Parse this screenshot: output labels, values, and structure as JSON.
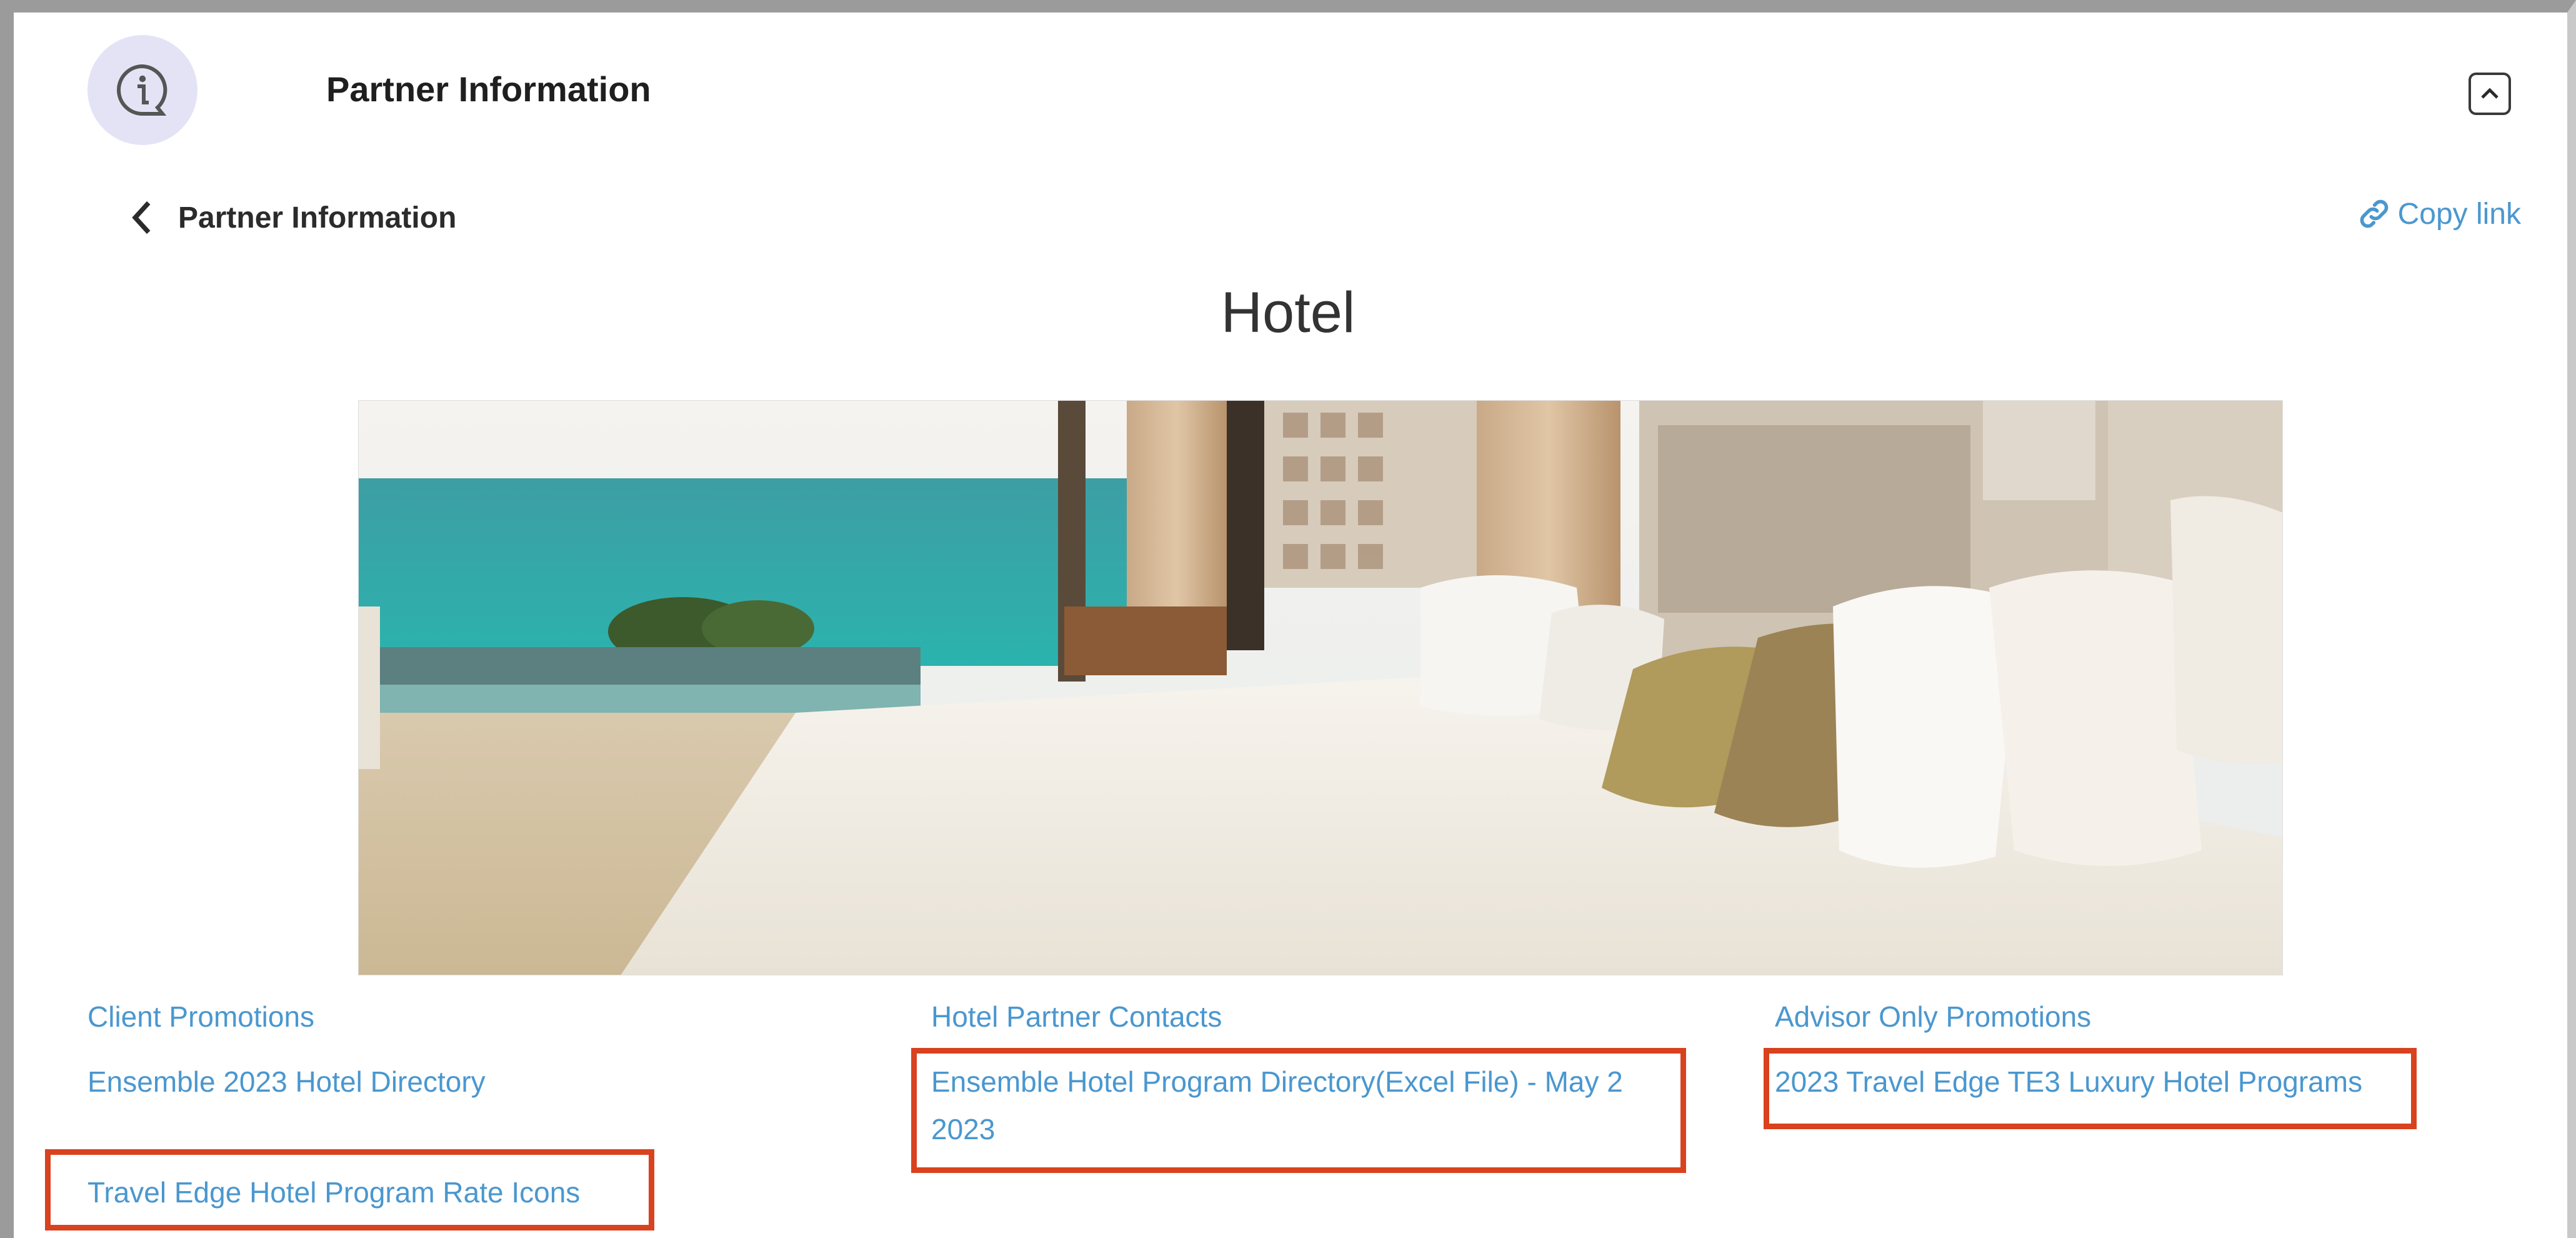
{
  "header": {
    "title": "Partner Information",
    "icon": "info-chat-icon",
    "collapse_icon": "chevron-up-icon"
  },
  "nav": {
    "back_label": "Partner Information",
    "back_icon": "chevron-left-icon",
    "copy_link_label": "Copy link",
    "copy_link_icon": "link-icon"
  },
  "page": {
    "title": "Hotel",
    "hero_image": "luxury-hotel-bedroom-ocean-view"
  },
  "links": {
    "col1": [
      "Client Promotions",
      "Ensemble 2023 Hotel Directory",
      "Travel Edge Hotel Program Rate Icons"
    ],
    "col2": [
      "Hotel Partner Contacts",
      "Ensemble Hotel Program Directory(Excel File) - May 2 2023"
    ],
    "col3": [
      "Advisor Only Promotions",
      "2023 Travel Edge TE3 Luxury Hotel Programs"
    ]
  },
  "colors": {
    "link": "#4a97cf",
    "highlight": "#d9421e",
    "icon_bg": "#e4e3f6"
  }
}
